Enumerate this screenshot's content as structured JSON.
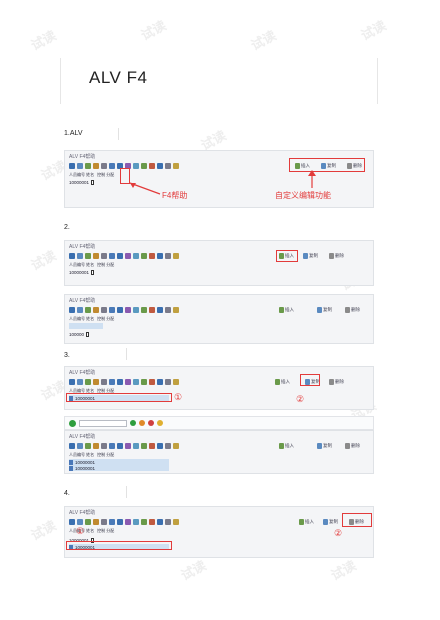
{
  "title": "ALV     F4",
  "sections": [
    {
      "label": "1.ALV"
    },
    {
      "label": "2."
    },
    {
      "label": "3."
    },
    {
      "label": "4."
    }
  ],
  "alv": {
    "window_title": "ALV F4帮助",
    "header_cols": [
      "人员编号 姓名",
      "控制 分配"
    ],
    "insert_label": "插入",
    "copy_label": "复制",
    "delete_label": "删除",
    "row_value": "10000001",
    "row_value_short": "100000"
  },
  "annotations": {
    "f4_help": "F4帮助",
    "custom_edit": "自定义编辑功能",
    "circle1": "①",
    "circle2": "②"
  },
  "watermark": "试读",
  "colors": {
    "accent_red": "#e23b3b",
    "toolbar_bg": "#f4f5f7"
  }
}
